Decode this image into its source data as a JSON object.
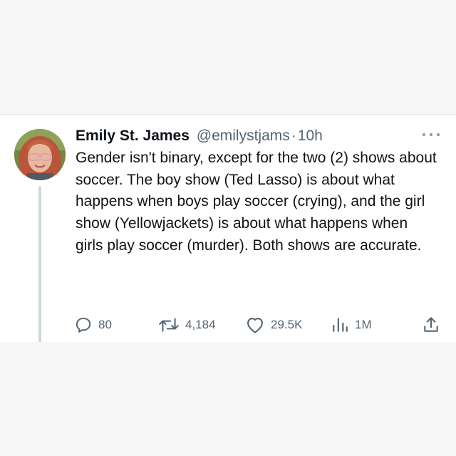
{
  "tweet": {
    "author_name": "Emily St. James",
    "handle": "@emilystjams",
    "separator": "·",
    "time": "10h",
    "text": "Gender isn't binary, except for the two (2) shows about soccer. The boy show (Ted Lasso) is about what happens when boys play soccer (crying), and the girl show (Yellowjackets) is about what happens when girls play soccer (murder). Both shows are accurate.",
    "stats": {
      "replies": "80",
      "retweets": "4,184",
      "likes": "29.5K",
      "views": "1M"
    }
  },
  "icons": {
    "more": "more-horizontal-icon",
    "reply": "reply-icon",
    "retweet": "retweet-icon",
    "like": "heart-icon",
    "views": "views-icon",
    "share": "share-icon"
  },
  "colors": {
    "text": "#0f1419",
    "muted": "#536471",
    "background": "#ffffff",
    "page_background": "#f7f7f8"
  }
}
